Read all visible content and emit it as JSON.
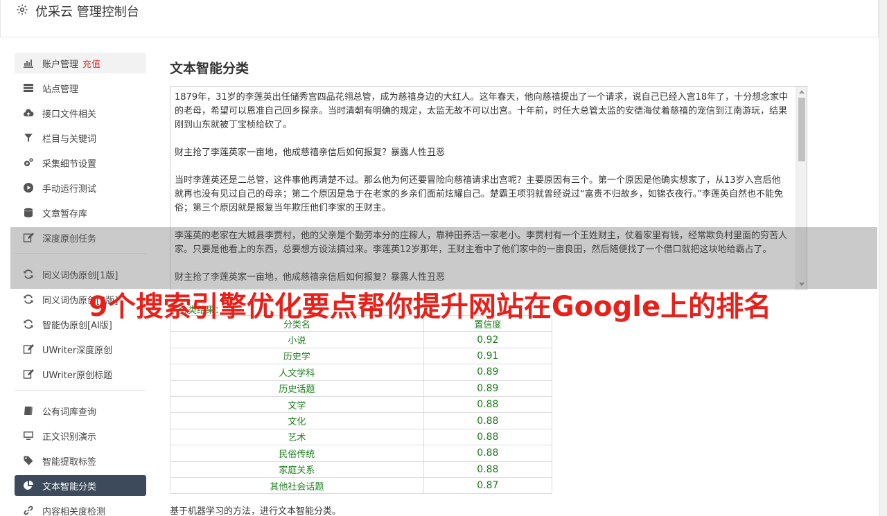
{
  "header": {
    "title": "优采云 管理控制台"
  },
  "sidebar": {
    "items": [
      {
        "label": "账户管理",
        "extra": "充值",
        "icon": "bar-chart-icon"
      },
      {
        "label": "站点管理",
        "icon": "server-icon"
      },
      {
        "label": "接口文件相关",
        "icon": "cloud-upload-icon"
      },
      {
        "label": "栏目与关键词",
        "icon": "filter-icon"
      },
      {
        "label": "采集细节设置",
        "icon": "gears-icon"
      },
      {
        "label": "手动运行测试",
        "icon": "play-circle-icon"
      },
      {
        "label": "文章暂存库",
        "icon": "database-icon"
      },
      {
        "label": "深度原创任务",
        "icon": "edit-icon"
      },
      {
        "label": "同义词伪原创[1版]",
        "icon": "refresh-icon"
      },
      {
        "label": "同义词伪原创[2版]",
        "icon": "refresh-icon"
      },
      {
        "label": "智能伪原创[AI版]",
        "icon": "refresh-icon"
      },
      {
        "label": "UWriter深度原创",
        "icon": "edit-icon"
      },
      {
        "label": "UWriter原创标题",
        "icon": "edit-icon"
      },
      {
        "label": "公有词库查询",
        "icon": "book-icon"
      },
      {
        "label": "正文识别演示",
        "icon": "monitor-icon"
      },
      {
        "label": "智能提取标签",
        "icon": "tag-icon"
      },
      {
        "label": "文本智能分类",
        "icon": "pie-chart-icon"
      },
      {
        "label": "内容相关度检测",
        "icon": "link-icon"
      }
    ]
  },
  "main": {
    "title": "文本智能分类",
    "text": "1879年，31岁的李莲英出任储秀宫四品花翎总管，成为慈禧身边的大红人。这年春天，他向慈禧提出了一个请求，说自己已经入宫18年了，十分想念家中的老母，希望可以恩准自己回乡探亲。当时清朝有明确的规定，太监无故不可以出宫。十年前，时任大总管太监的安德海仗着慈禧的宠信到江南游玩，结果刚到山东就被丁宝桢给砍了。\n\n财主抢了李莲英家一亩地，他成慈禧亲信后如何报复？暴露人性丑恶\n\n当时李莲英还是二总管，这件事他再清楚不过。那么他为何还要冒险向慈禧请求出宫呢？主要原因有三个。第一个原因是他确实想家了，从13岁入宫后他就再也没有见过自己的母亲；第二个原因是急于在老家的乡亲们面前炫耀自己。楚霸王项羽就曾经说过“富贵不归故乡，如锦衣夜行。”李莲英自然也不能免俗；第三个原因就是报复当年欺压他们李家的王财主。\n\n李莲英的老家在大城县李贾村，他的父亲是个勤劳本分的庄稼人，靠种田养活一家老小。李贾村有一个王姓财主，仗着家里有钱，经常欺负村里面的穷苦人家。只要是他看上的东西，总要想方设法搞过来。李莲英12岁那年，王财主看中了他们家中的一亩良田，然后随便找了一个借口就把这块地给霸占了。\n\n财主抢了李莲英家一亩地，他成慈禧亲信后如何报复？暴露人性丑恶",
    "result_label": "分类结果：",
    "table": {
      "headers": [
        "分类名",
        "置信度"
      ],
      "rows": [
        [
          "小说",
          "0.92"
        ],
        [
          "历史学",
          "0.91"
        ],
        [
          "人文学科",
          "0.89"
        ],
        [
          "历史话题",
          "0.89"
        ],
        [
          "文学",
          "0.88"
        ],
        [
          "文化",
          "0.88"
        ],
        [
          "艺术",
          "0.88"
        ],
        [
          "民俗传统",
          "0.88"
        ],
        [
          "家庭关系",
          "0.88"
        ],
        [
          "其他社会话题",
          "0.87"
        ]
      ]
    },
    "footnote": "基于机器学习的方法，进行文本智能分类。"
  },
  "overlay": {
    "headline": "9个搜索引擎优化要点帮你提升网站在Google上的排名"
  },
  "colors": {
    "accent_active": "#3c4a5c",
    "recharge": "#e53935",
    "result_green": "#1a7f1a",
    "headline_red": "#e8201a"
  }
}
